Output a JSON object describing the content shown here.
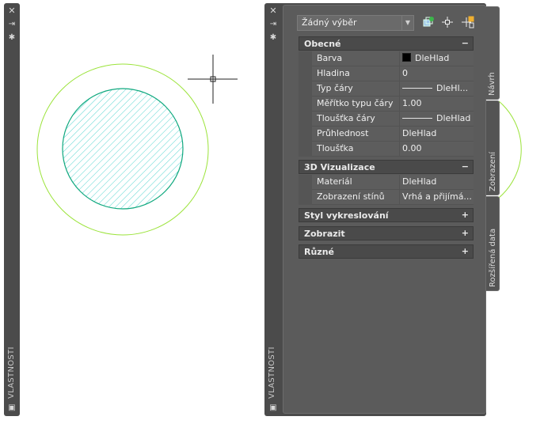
{
  "left_palette": {
    "title": "VLASTNOSTI",
    "icons": [
      "close-icon",
      "auto-hide-icon",
      "settings-icon",
      "properties-icon"
    ]
  },
  "palette": {
    "title": "VLASTNOSTI",
    "selection": "Žádný výběr",
    "toolbar_icons": [
      "quick-select-icon",
      "select-objects-icon",
      "toggle-pickadd-icon"
    ],
    "categories": [
      {
        "label": "Obecné",
        "toggle": "−",
        "rows": [
          {
            "name": "Barva",
            "value": "DleHlad",
            "kind": "color",
            "color": "#000000"
          },
          {
            "name": "Hladina",
            "value": "0"
          },
          {
            "name": "Typ čáry",
            "value": "DleHl...",
            "kind": "linetype"
          },
          {
            "name": "Měřítko typu čáry",
            "value": "1.00"
          },
          {
            "name": "Tloušťka čáry",
            "value": "DleHlad",
            "kind": "linetype"
          },
          {
            "name": "Průhlednost",
            "value": "DleHlad"
          },
          {
            "name": "Tloušťka",
            "value": "0.00"
          }
        ]
      },
      {
        "label": "3D Vizualizace",
        "toggle": "−",
        "rows": [
          {
            "name": "Materiál",
            "value": "DleHlad"
          },
          {
            "name": "Zobrazení stínů",
            "value": "Vrhá a přijímá..."
          }
        ]
      },
      {
        "label": "Styl vykreslování",
        "toggle": "+"
      },
      {
        "label": "Zobrazit",
        "toggle": "+"
      },
      {
        "label": "Různé",
        "toggle": "+"
      }
    ],
    "tabs": [
      "Návrh",
      "Zobrazení",
      "Rozšířená data"
    ]
  },
  "colors": {
    "outer_circle": "#9be33a",
    "inner_circle": "#0fa87e",
    "hatch": "#53d4cf",
    "panel_bg": "#4b4b4b"
  }
}
